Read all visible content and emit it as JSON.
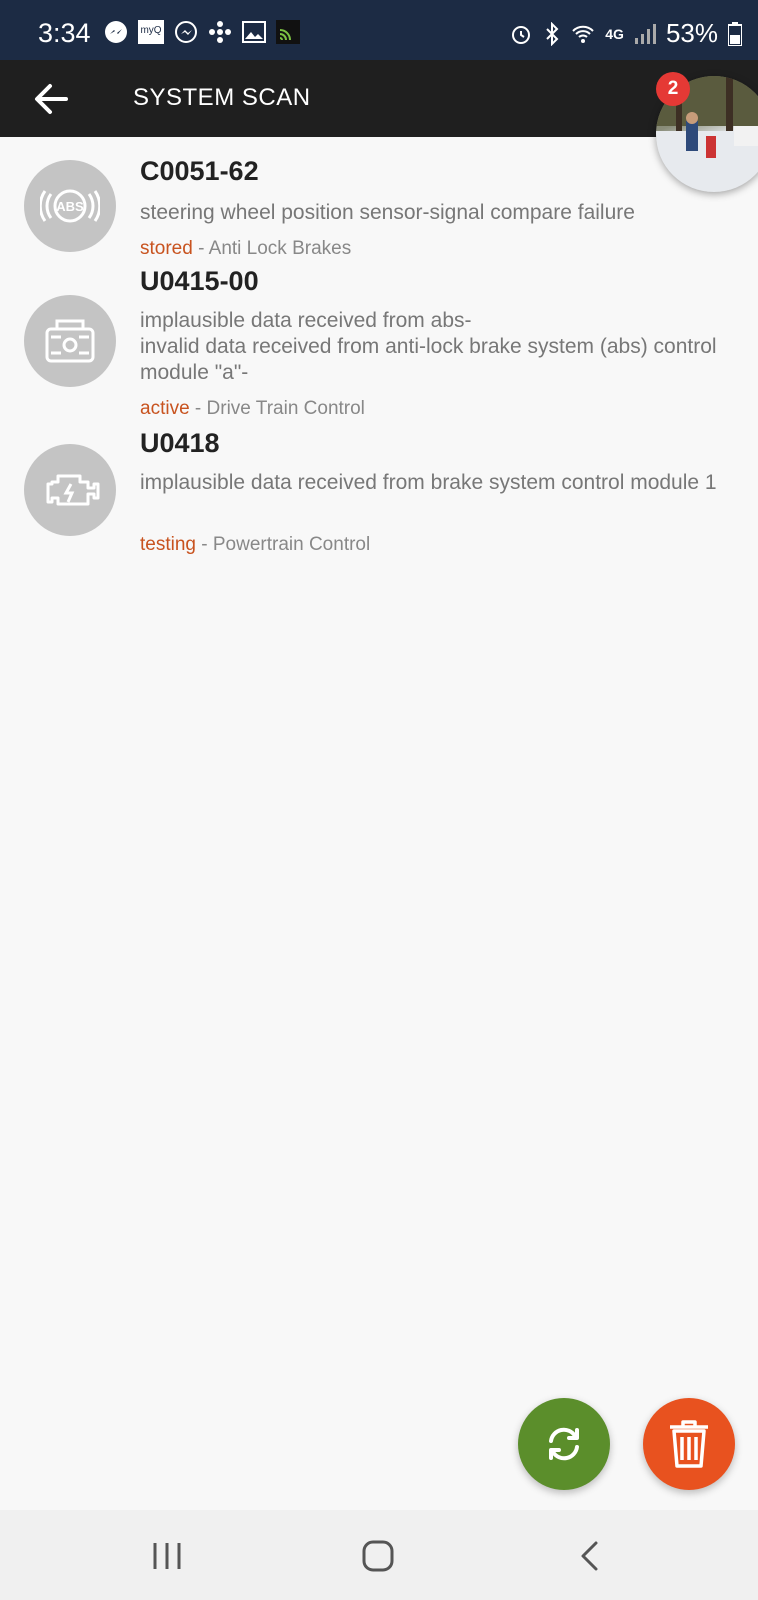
{
  "status_bar": {
    "time": "3:34",
    "myq_label": "myQ",
    "network": "4G",
    "battery": "53%",
    "icons_left": [
      "messenger-icon",
      "myq-icon",
      "messenger-outline-icon",
      "fan-icon",
      "gallery-icon",
      "cast-icon"
    ],
    "icons_right": [
      "alarm-icon",
      "bluetooth-icon",
      "wifi-icon",
      "lte-icon",
      "signal-icon",
      "battery-icon"
    ]
  },
  "app_bar": {
    "title": "SYSTEM SCAN",
    "back_icon": "arrow-left-icon"
  },
  "chat_head": {
    "badge_count": "2"
  },
  "codes": [
    {
      "code": "C0051-62",
      "description": "steering wheel position sensor-signal compare failure",
      "status": "stored",
      "module": " - Anti Lock Brakes",
      "icon": "abs-icon"
    },
    {
      "code": "U0415-00",
      "description": "implausible data received from abs-\ninvalid data received from anti-lock brake system (abs) control module \"a\"-",
      "status": "active",
      "module": " - Drive Train Control",
      "icon": "transmission-icon"
    },
    {
      "code": "U0418",
      "description": "implausible data received from brake system control module 1",
      "status": "testing",
      "module": " - Powertrain Control",
      "icon": "engine-icon"
    }
  ],
  "fabs": {
    "refresh_icon": "refresh-icon",
    "delete_icon": "trash-icon"
  },
  "nav_bar": {
    "icons": [
      "recents-icon",
      "home-icon",
      "back-icon"
    ]
  },
  "colors": {
    "status_bar_bg": "#1c2b44",
    "app_bar_bg": "#1f1f1f",
    "status_text": "#c8531f",
    "refresh_fab": "#5b8e2b",
    "delete_fab": "#e8521f",
    "badge": "#e53935"
  }
}
